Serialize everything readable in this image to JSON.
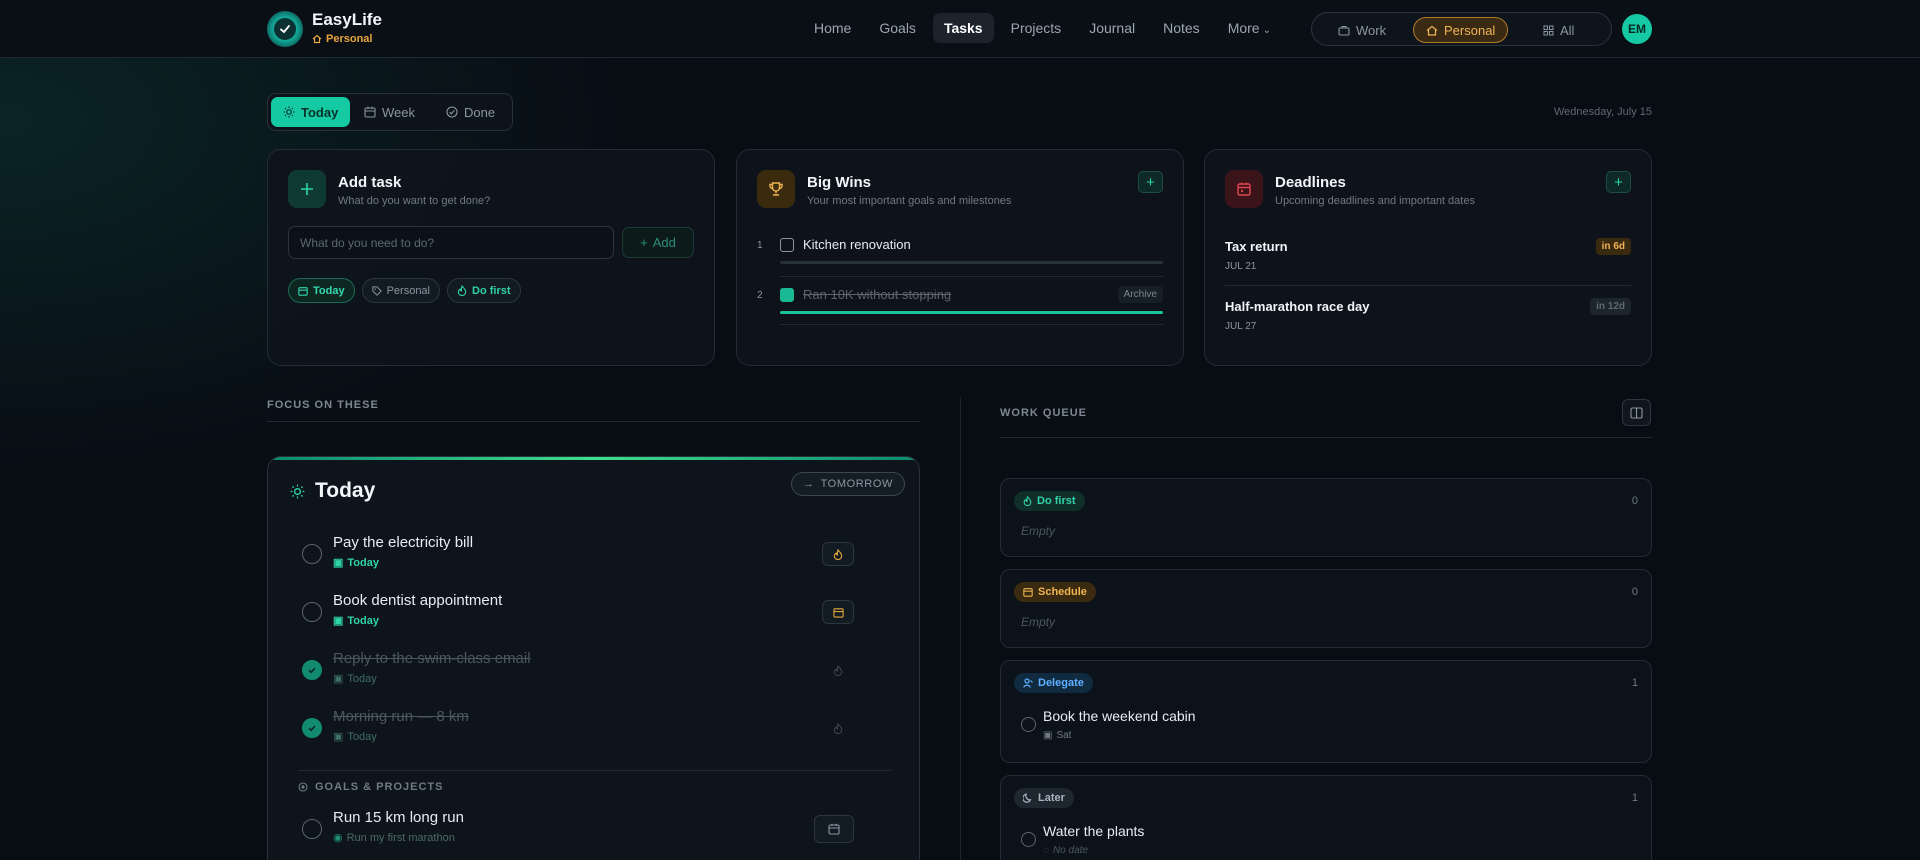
{
  "app": {
    "name": "EasyLife",
    "space_label": "Personal"
  },
  "nav": {
    "items": [
      {
        "label": "Home"
      },
      {
        "label": "Goals"
      },
      {
        "label": "Tasks",
        "active": true
      },
      {
        "label": "Projects"
      },
      {
        "label": "Journal"
      },
      {
        "label": "Notes"
      }
    ],
    "more_label": "More"
  },
  "spaces": {
    "work": "Work",
    "personal": "Personal",
    "all": "All",
    "active": "Personal"
  },
  "user": {
    "initials": "EM"
  },
  "view_tabs": {
    "today": "Today",
    "week": "Week",
    "done": "Done",
    "active": "Today"
  },
  "date": "Wednesday, July 15",
  "add_task": {
    "title": "Add task",
    "subtitle": "What do you want to get done?",
    "placeholder": "What do you need to do?",
    "add_label": "Add",
    "chips": {
      "when": "Today",
      "space": "Personal",
      "priority": "Do first"
    }
  },
  "big_wins": {
    "title": "Big Wins",
    "subtitle": "Your most important goals and milestones",
    "items": [
      {
        "num": "1",
        "label": "Kitchen renovation",
        "done": false
      },
      {
        "num": "2",
        "label": "Ran 10K without stopping",
        "done": true,
        "action": "Archive"
      }
    ]
  },
  "deadlines": {
    "title": "Deadlines",
    "subtitle": "Upcoming deadlines and important dates",
    "items": [
      {
        "title": "Tax return",
        "date": "JUL 21",
        "badge": "in 6d"
      },
      {
        "title": "Half-marathon race day",
        "date": "JUL 27",
        "badge": "in 12d"
      }
    ]
  },
  "focus": {
    "section_label": "FOCUS ON THESE",
    "panel_title": "Today",
    "tomorrow_label": "TOMORROW",
    "tasks": [
      {
        "label": "Pay the electricity bill",
        "meta": "Today",
        "done": false,
        "action_icon": "flame-icon"
      },
      {
        "label": "Book dentist appointment",
        "meta": "Today",
        "done": false,
        "action_icon": "calendar-icon"
      },
      {
        "label": "Reply to the swim-class email",
        "meta": "Today",
        "done": true,
        "action_icon": "flame-icon"
      },
      {
        "label": "Morning run — 8 km",
        "meta": "Today",
        "done": true,
        "action_icon": "flame-icon"
      }
    ],
    "goals_label": "GOALS & PROJECTS",
    "goal_tasks": [
      {
        "label": "Run 15 km long run",
        "meta": "Run my first marathon"
      }
    ]
  },
  "queue": {
    "section_label": "WORK QUEUE",
    "empty_label": "Empty",
    "groups": [
      {
        "tag": "Do first",
        "count": "0"
      },
      {
        "tag": "Schedule",
        "count": "0"
      },
      {
        "tag": "Delegate",
        "count": "1",
        "item": "Book the weekend cabin",
        "item_meta": "Sat"
      },
      {
        "tag": "Later",
        "count": "1",
        "item": "Water the plants",
        "item_meta": "No date"
      }
    ]
  },
  "colors": {
    "accent": "#15c9a2",
    "personal": "#f0b452",
    "deadline": "#e0454f"
  }
}
